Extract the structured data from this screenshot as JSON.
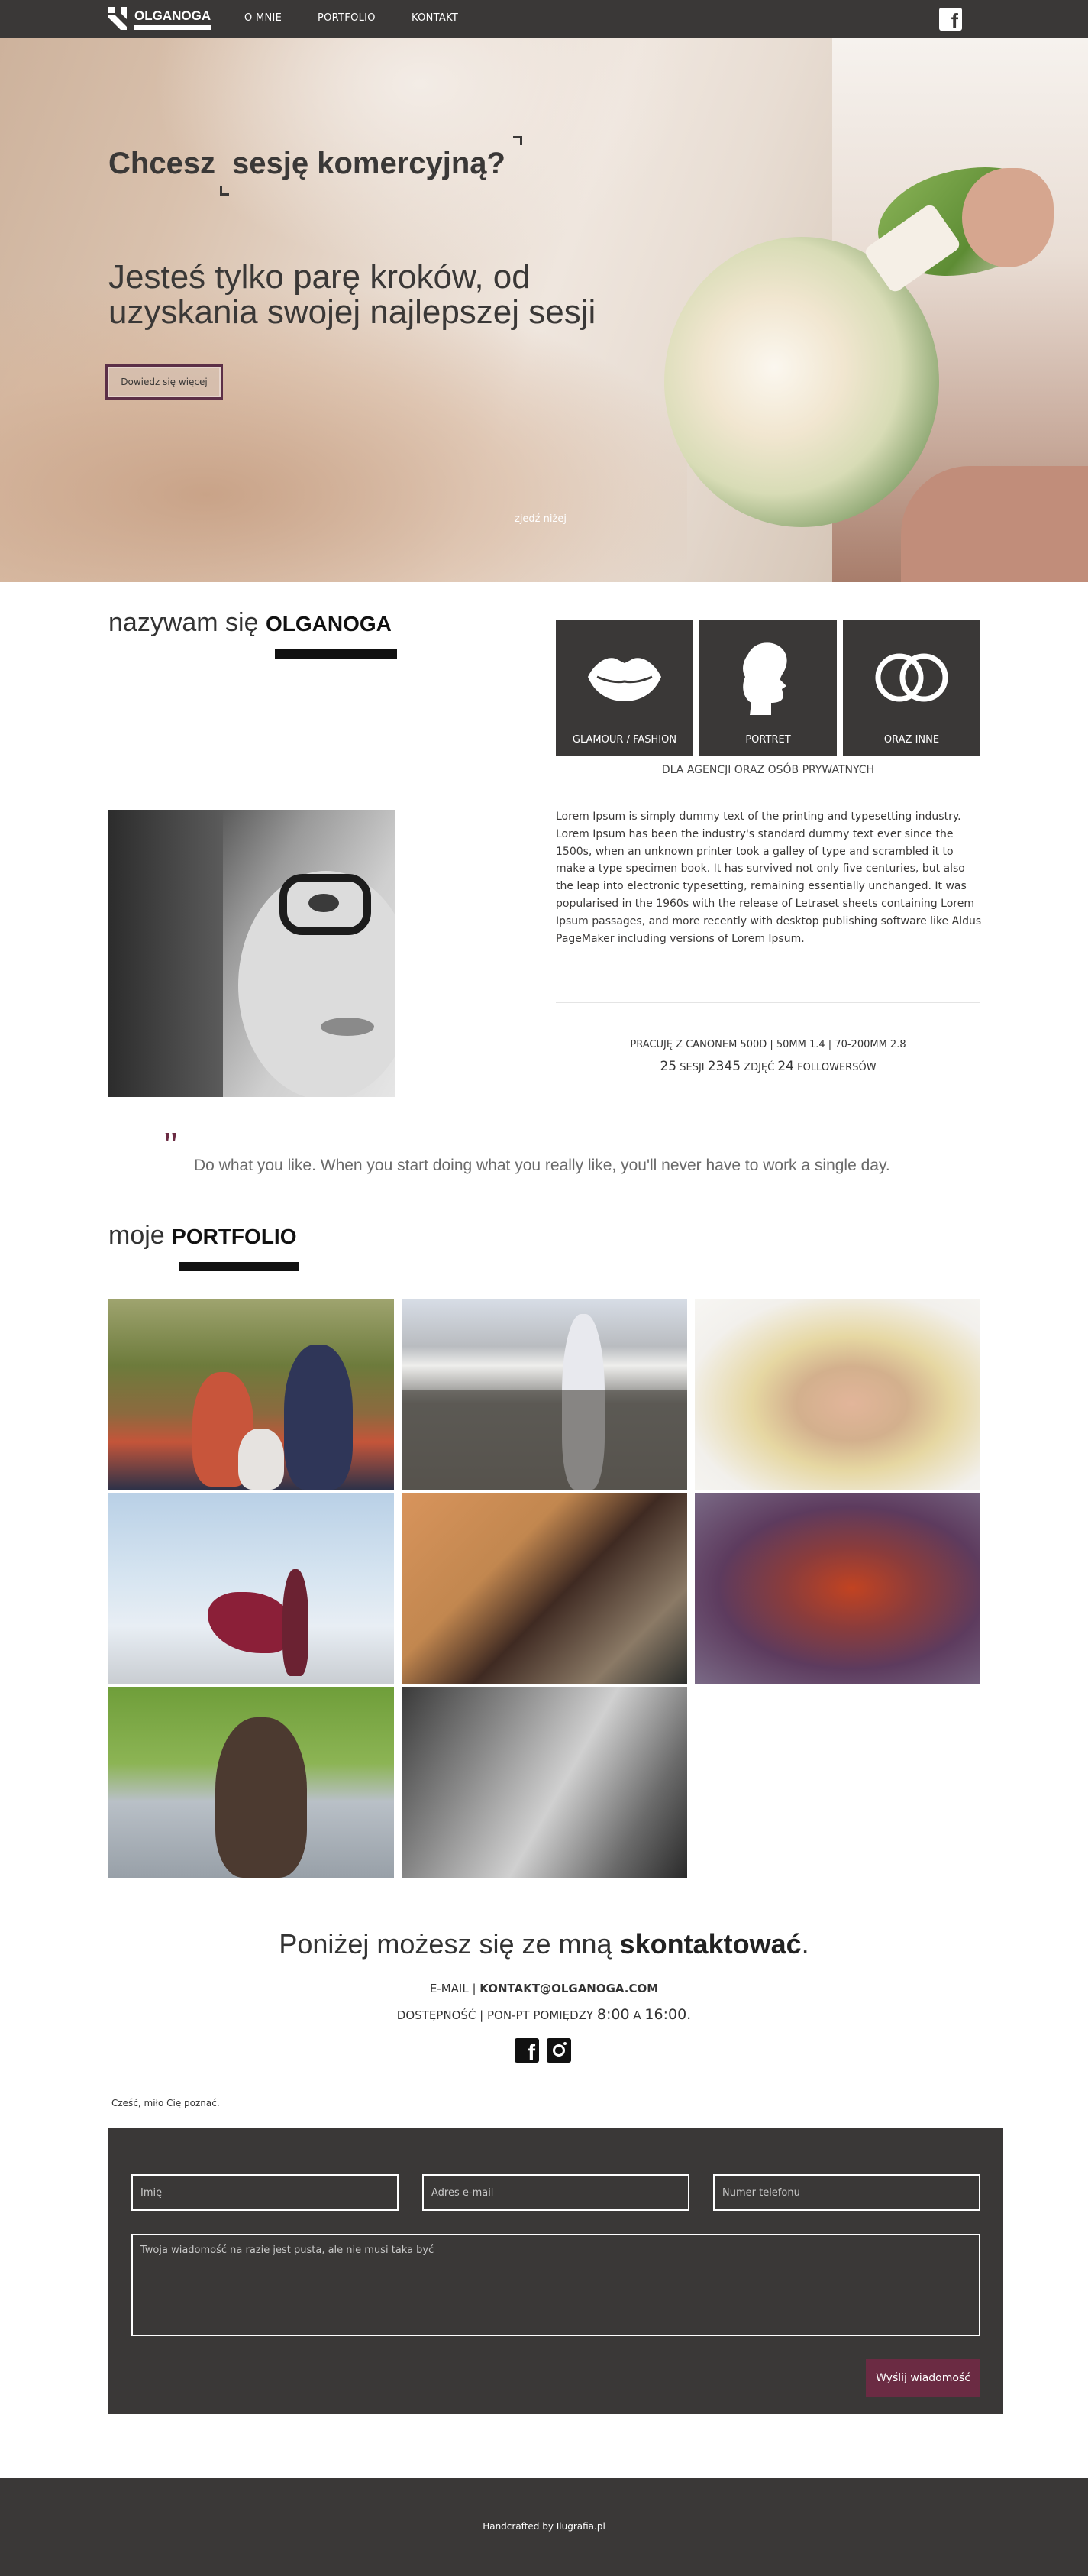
{
  "nav": {
    "brand": "OLGANOGA",
    "links": [
      "O MNIE",
      "PORTFOLIO",
      "KONTAKT"
    ],
    "social_icon": "facebook-icon"
  },
  "hero": {
    "word1": "Chcesz",
    "word2": "sesję komercyjną?",
    "subtitle": "Jesteś tylko parę kroków, od uzyskania swojej najlepszej sesji",
    "button": "Dowiedz się więcej",
    "scroll_hint": "zjedź niżej"
  },
  "about": {
    "title_prefix": "nazywam się",
    "title_name": "OLGANOGA",
    "tiles": [
      {
        "label": "GLAMOUR / FASHION",
        "icon": "lips-icon"
      },
      {
        "label": "PORTRET",
        "icon": "profile-icon"
      },
      {
        "label": "ORAZ INNE",
        "icon": "rings-icon"
      }
    ],
    "tiles_caption": "DLA AGENCJI ORAZ OSÓB PRYWATNYCH",
    "body": "Lorem Ipsum is simply dummy text of the printing and typesetting industry. Lorem Ipsum has been the industry's standard dummy text ever since the 1500s, when an unknown printer took a galley of type and scrambled it to make a type specimen book. It has survived not only five centuries, but also the leap into electronic typesetting, remaining essentially unchanged. It was popularised in the 1960s with the release of Letraset sheets containing Lorem Ipsum passages, and more recently with desktop publishing software like Aldus PageMaker including versions of Lorem Ipsum.",
    "gear": "PRACUJĘ Z CANONEM 500D | 50MM 1.4 | 70-200MM 2.8",
    "stats": {
      "sessions_num": "25",
      "sessions_lbl": "SESJI",
      "photos_num": "2345",
      "photos_lbl": "ZDJĘĆ",
      "followers_num": "24",
      "followers_lbl": "FOLLOWERSÓW"
    }
  },
  "quote": {
    "mark": "\"",
    "text": "Do what you like. When you start doing what you really like, you'll never have to work a single day."
  },
  "portfolio": {
    "title_prefix": "moje",
    "title_name": "PORTFOLIO",
    "photo_count": 8
  },
  "contact": {
    "title_prefix": "Poniżej możesz się ze mną",
    "title_bold": "skontaktować",
    "title_suffix": ".",
    "email_label": "E-MAIL",
    "email": "KONTAKT@OLGANOGA.COM",
    "avail_label": "DOSTĘPNOŚĆ",
    "avail_days": "PON-PT POMIĘDZY",
    "avail_from": "8:00",
    "avail_and": "A",
    "avail_to": "16:00.",
    "greeting": "Cześć, miło Cię poznać.",
    "form": {
      "name_placeholder": "Imię",
      "email_placeholder": "Adres e-mail",
      "phone_placeholder": "Numer telefonu",
      "message_placeholder": "Twoja wiadomość na razie jest pusta, ale nie musi taka być",
      "submit": "Wyślij wiadomość"
    }
  },
  "footer": {
    "text": "Handcrafted by Ilugrafia.pl"
  },
  "colors": {
    "dark": "#3a3837",
    "accent": "#6b2b43",
    "white": "#ffffff"
  }
}
